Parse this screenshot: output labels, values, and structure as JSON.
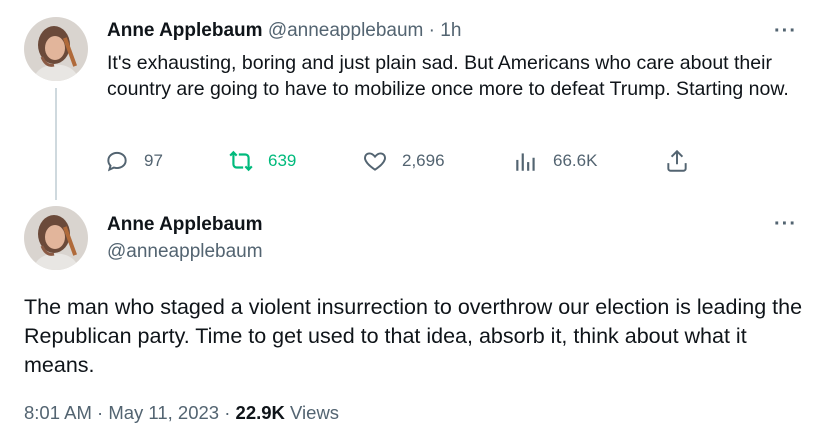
{
  "tweet1": {
    "name": "Anne Applebaum",
    "handle": "@anneapplebaum",
    "separator": "·",
    "time": "1h",
    "more": "···",
    "text": "It's exhausting, boring and just plain sad. But Americans who care about their country are going to have to mobilize once more to defeat Trump. Starting now.",
    "actions": {
      "replies": "97",
      "retweets": "639",
      "likes": "2,696",
      "views": "66.6K"
    }
  },
  "tweet2": {
    "name": "Anne Applebaum",
    "handle": "@anneapplebaum",
    "more": "···",
    "text": "The man who staged a violent insurrection to overthrow our election is leading the Republican party. Time to get used to that idea, absorb it, think about what it means.",
    "time": "8:01 AM",
    "date": "May 11, 2023",
    "separator": "·",
    "views_count": "22.9K",
    "views_label": "Views"
  },
  "colors": {
    "text": "#0f1419",
    "secondary": "#536471",
    "retweet_active": "#00ba7c",
    "thread_line": "#cfd9de"
  },
  "icons": {
    "reply": "reply-icon",
    "retweet": "retweet-icon",
    "like": "heart-icon",
    "views": "analytics-icon",
    "share": "share-icon"
  }
}
